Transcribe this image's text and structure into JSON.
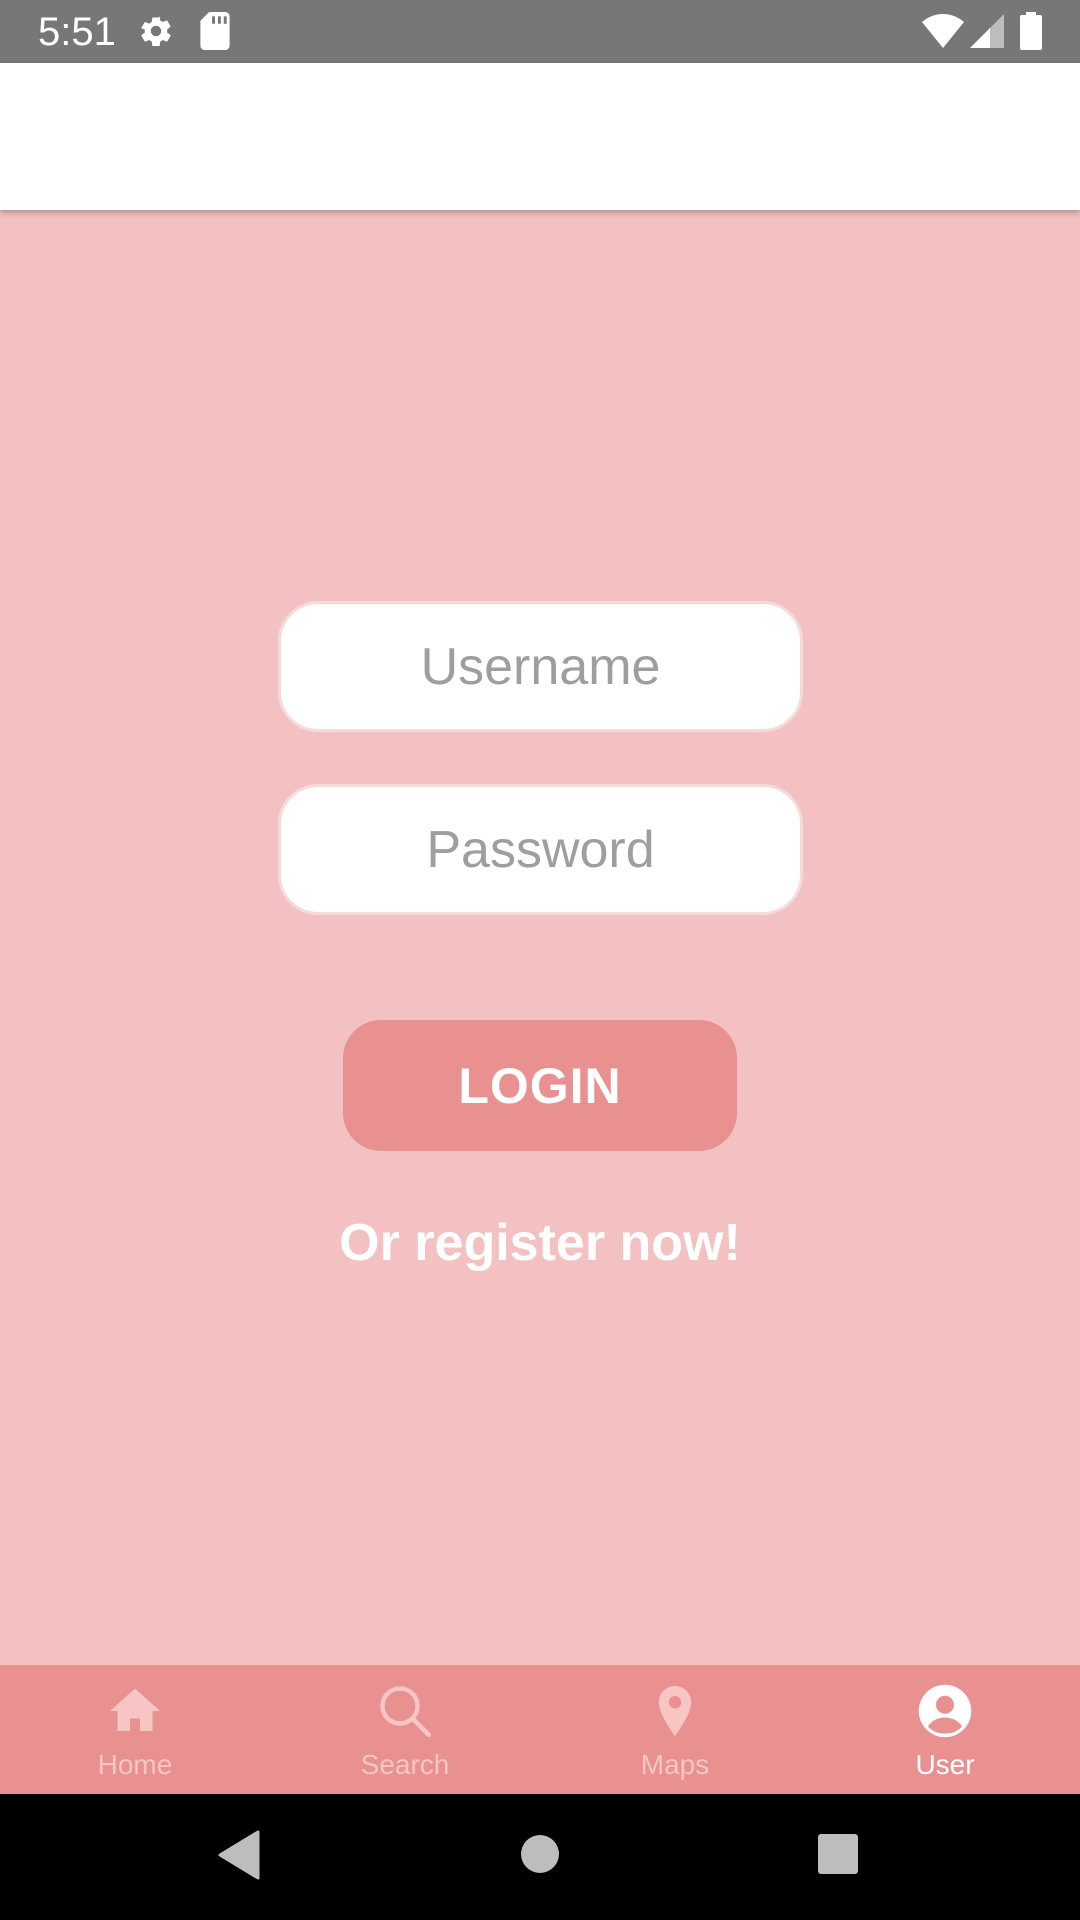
{
  "status_bar": {
    "time": "5:51",
    "icons": [
      "gear-icon",
      "sd-card-icon",
      "wifi-icon",
      "signal-icon",
      "battery-icon"
    ]
  },
  "login_form": {
    "username_placeholder": "Username",
    "username_value": "",
    "password_placeholder": "Password",
    "password_value": "",
    "login_label": "LOGIN",
    "register_label": "Or register now!"
  },
  "bottom_nav": {
    "items": [
      {
        "label": "Home",
        "icon": "home-icon",
        "active": false
      },
      {
        "label": "Search",
        "icon": "search-icon",
        "active": false
      },
      {
        "label": "Maps",
        "icon": "map-pin-icon",
        "active": false
      },
      {
        "label": "User",
        "icon": "user-icon",
        "active": true
      }
    ]
  },
  "system_nav": {
    "icons": [
      "back-icon",
      "home-circle-icon",
      "recents-icon"
    ]
  },
  "colors": {
    "background": "#f3c1c1",
    "accent": "#e99190",
    "status_bar": "#777777",
    "nav_inactive": "#f6c5c4",
    "nav_active": "#ffffff"
  }
}
